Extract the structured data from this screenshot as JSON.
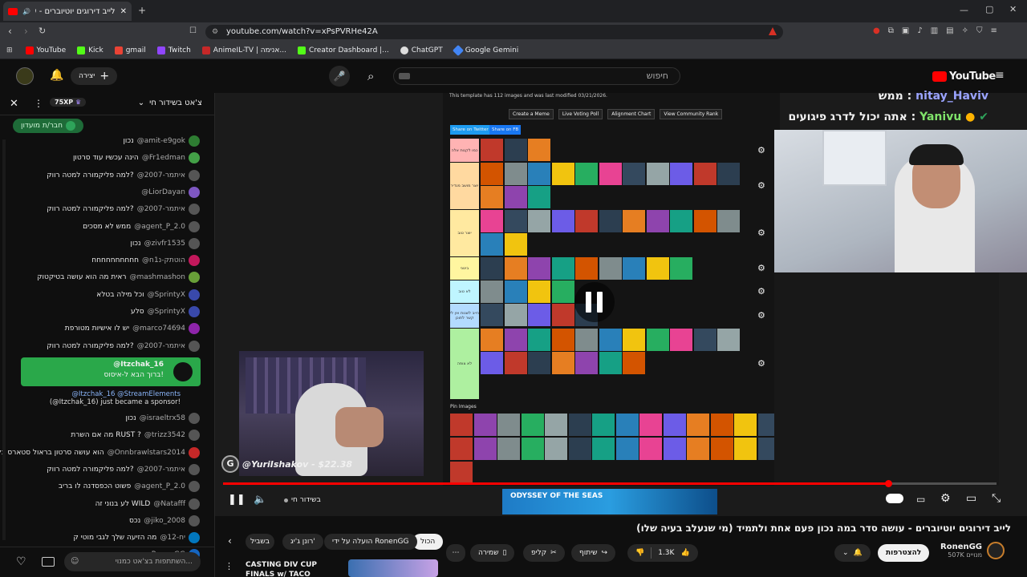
{
  "browser": {
    "tab_title": "לייב דירוגים יוטיוברים - עושה",
    "url": "youtube.com/watch?v=xPsPVRHe42A",
    "bookmarks": [
      "YouTube",
      "Kick",
      "gmail",
      "Twitch",
      "AnimeIL-TV | אנימה...",
      "Creator Dashboard |...",
      "ChatGPT",
      "Google Gemini"
    ]
  },
  "youtube": {
    "logo": "YouTube",
    "search_placeholder": "חיפוש",
    "create_label": "יצירה"
  },
  "chat": {
    "title": "צ'אט בשידור חי",
    "xp": "75XP",
    "member_button": "חבר/ת מועדון",
    "messages": [
      {
        "user": "@amit-e9gok",
        "text": "נכון",
        "color": "#2e7d32"
      },
      {
        "user": "@Fr1edman",
        "text": "הינה עכשיו עוד סרטון",
        "color": "#43a047"
      },
      {
        "user": "@איתמר-2007",
        "text": "למה פליקמורה למטה רווק?",
        "color": "#555555"
      },
      {
        "user": "@LiorDayan",
        "text": "",
        "color": "#7e57c2"
      },
      {
        "user": "@איתמר-2007",
        "text": "למה פליקמורה למטה רווק?",
        "color": "#555555"
      },
      {
        "user": "@agent_P_2.0",
        "text": "ממש לא מסכים",
        "color": "#555555"
      },
      {
        "user": "@zivfr1535",
        "text": "נכון",
        "color": "#555555"
      },
      {
        "user": "@הוטתק-נ1ח",
        "text": "חחחחחחחחחח",
        "color": "#c2185b"
      },
      {
        "user": "@mashmashon",
        "text": "ראית מה הוא עושה בטיקטוק",
        "color": "#689f38"
      },
      {
        "user": "@SprintyX",
        "text": "וכל מילה בטלא",
        "color": "#3949ab"
      },
      {
        "user": "@SprintyX",
        "text": "סלע",
        "color": "#3949ab"
      },
      {
        "user": "@marco74694",
        "text": "יש לו אישיות מטורפת",
        "color": "#8e24aa"
      },
      {
        "user": "@איתמר-2007",
        "text": "למה פליקמורה למטה רווק?",
        "color": "#555555"
      }
    ],
    "highlight": {
      "user": "@Itzchak_16",
      "text": "ברוך הבא ל-איסוס!"
    },
    "sponsor_line1": "@Itzchak_16 @StreamElements",
    "sponsor_line2": "(@Itzchak_16) just became a sponsor!",
    "messages2": [
      {
        "user": "@israeltrx58",
        "text": "נכון",
        "color": "#555555"
      },
      {
        "user": "@trizz3542",
        "text": "מה אם השרת RUST ?",
        "color": "#555555"
      },
      {
        "user": "@Onnbrawlstars2014",
        "text": "הוא עושה סרטון בראול סטארס כל יום",
        "color": "#c62828"
      },
      {
        "user": "@איתמר-2007",
        "text": "למה פליקמורה למטה רווק?",
        "color": "#555555"
      },
      {
        "user": "@agent_P_2.0",
        "text": "פשוט הכפסדנה לו בריב",
        "color": "#555555"
      },
      {
        "user": "@Natafff",
        "text": "לע בנוני זה WILD",
        "color": "#555555"
      },
      {
        "user": "@jiko_2008",
        "text": "נכס",
        "color": "#555555"
      },
      {
        "user": "@יח-12",
        "text": "מה הזיעה שלך לגבי מוטי ק",
        "color": "#0277bd"
      },
      {
        "user": "RonenGG",
        "text": "",
        "color": "#1565c0"
      }
    ],
    "input_placeholder": "השתתפות בצ'אט כמנוי..."
  },
  "video": {
    "template_info": "This template has 112 images and was last modified 03/21/2026.",
    "buttons": [
      "Create a Meme",
      "Live Voting Poll",
      "Alignment Chart",
      "View Community Rank"
    ],
    "share_twitter": "Share on Twitter",
    "share_fb": "Share on FB",
    "tiers": [
      {
        "label": "כמו לקנות אלה",
        "color": "#ffb3b3"
      },
      {
        "label": "יוצר מושב מגדיר",
        "color": "#ffd9a0"
      },
      {
        "label": "יוצר טוב",
        "color": "#ffe9a0"
      },
      {
        "label": "בינוני",
        "color": "#fff6a0"
      },
      {
        "label": "לא טוב",
        "color": "#bff5ff"
      },
      {
        "label": "הייב לשנות אין לי קשר לתוכן",
        "color": "#b3dbff"
      },
      {
        "label": "לא צופה",
        "color": "#aef0a0"
      }
    ],
    "pin_images": "Pin Images",
    "overlay_name": "@YuriIshakov - $22.38",
    "chat_overlay_user": "nitay_Haviv",
    "chat_overlay_text": "ממש",
    "chat_overlay_user2": "Yanivu",
    "chat_overlay_text2": "אתה יכול לדרג פיגועים",
    "live_label": "בשידור חי",
    "ad_text": "ODYSSEY OF THE SEAS",
    "progress": 0.86
  },
  "meta": {
    "title": "לייב דירוגים יוטיוברים - עושה סדר במה נכון פעם אחת ולתמיד (מי שנעלב בעיה שלו)",
    "channel": "RonenGG",
    "subscribers": "507K מנויים",
    "subscribe": "להצטרפות",
    "likes": "1.3K",
    "share": "שיתוף",
    "clip": "קליפ",
    "save": "שמירה",
    "chips": [
      "הכול",
      "הועלה על ידי RonenGG",
      "רונן ג'יג'",
      "בשביל"
    ],
    "rec_title": "CASTING DIV CUP FINALS w/ TACO"
  }
}
